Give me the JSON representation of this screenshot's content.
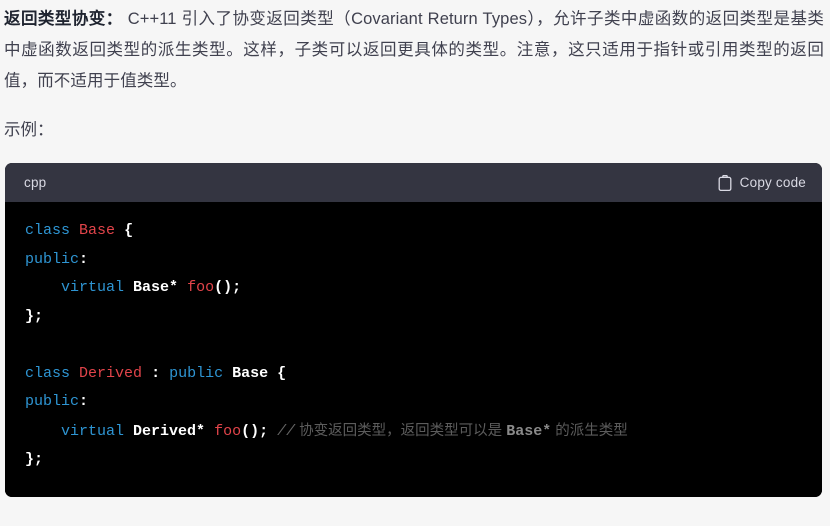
{
  "article": {
    "paragraph": {
      "lead": "返回类型协变：",
      "body": " C++11 引入了协变返回类型（Covariant Return Types），允许子类中虚函数的返回类型是基类中虚函数返回类型的派生类型。这样，子类可以返回更具体的类型。注意，这只适用于指针或引用类型的返回值，而不适用于值类型。"
    },
    "example_label": "示例："
  },
  "code_block": {
    "language": "cpp",
    "copy_label": "Copy code",
    "copy_icon": "clipboard-icon",
    "lines": [
      {
        "id": 1,
        "tokens": [
          {
            "t": "class",
            "c": "kw"
          },
          {
            "t": " ",
            "c": "pln"
          },
          {
            "t": "Base",
            "c": "type"
          },
          {
            "t": " ",
            "c": "pln"
          },
          {
            "t": "{",
            "c": "punc"
          }
        ]
      },
      {
        "id": 2,
        "tokens": [
          {
            "t": "public",
            "c": "kw"
          },
          {
            "t": ":",
            "c": "punc"
          }
        ]
      },
      {
        "id": 3,
        "tokens": [
          {
            "t": "    ",
            "c": "pln"
          },
          {
            "t": "virtual",
            "c": "kw"
          },
          {
            "t": " ",
            "c": "pln"
          },
          {
            "t": "Base*",
            "c": "pln"
          },
          {
            "t": " ",
            "c": "pln"
          },
          {
            "t": "foo",
            "c": "fn"
          },
          {
            "t": "();",
            "c": "punc"
          }
        ]
      },
      {
        "id": 4,
        "tokens": [
          {
            "t": "};",
            "c": "punc"
          }
        ]
      },
      {
        "id": 5,
        "tokens": []
      },
      {
        "id": 6,
        "tokens": [
          {
            "t": "class",
            "c": "kw"
          },
          {
            "t": " ",
            "c": "pln"
          },
          {
            "t": "Derived",
            "c": "type"
          },
          {
            "t": " ",
            "c": "pln"
          },
          {
            "t": ":",
            "c": "punc"
          },
          {
            "t": " ",
            "c": "pln"
          },
          {
            "t": "public",
            "c": "kw"
          },
          {
            "t": " ",
            "c": "pln"
          },
          {
            "t": "Base",
            "c": "pln"
          },
          {
            "t": " ",
            "c": "pln"
          },
          {
            "t": "{",
            "c": "punc"
          }
        ]
      },
      {
        "id": 7,
        "tokens": [
          {
            "t": "public",
            "c": "kw"
          },
          {
            "t": ":",
            "c": "punc"
          }
        ]
      },
      {
        "id": 8,
        "tokens": [
          {
            "t": "    ",
            "c": "pln"
          },
          {
            "t": "virtual",
            "c": "kw"
          },
          {
            "t": " ",
            "c": "pln"
          },
          {
            "t": "Derived*",
            "c": "pln"
          },
          {
            "t": " ",
            "c": "pln"
          },
          {
            "t": "foo",
            "c": "fn"
          },
          {
            "t": "();",
            "c": "punc"
          },
          {
            "t": " ",
            "c": "pln"
          },
          {
            "t": "//",
            "c": "cmt"
          },
          {
            "t": " 协变返回类型，返回类型可以是 ",
            "c": "cmt-cn"
          },
          {
            "t": "Base*",
            "c": "cmt-code"
          },
          {
            "t": " 的派生类型",
            "c": "cmt-cn"
          }
        ]
      },
      {
        "id": 9,
        "tokens": [
          {
            "t": "};",
            "c": "punc"
          }
        ]
      }
    ]
  },
  "colors": {
    "page_background": "#f6f6f6",
    "code_header_background": "#343541",
    "code_body_background": "#000000",
    "keyword": "#2e95d3",
    "type": "#e2444a",
    "plain": "#ffffff",
    "comment": "#656565",
    "text": "#40414f"
  }
}
